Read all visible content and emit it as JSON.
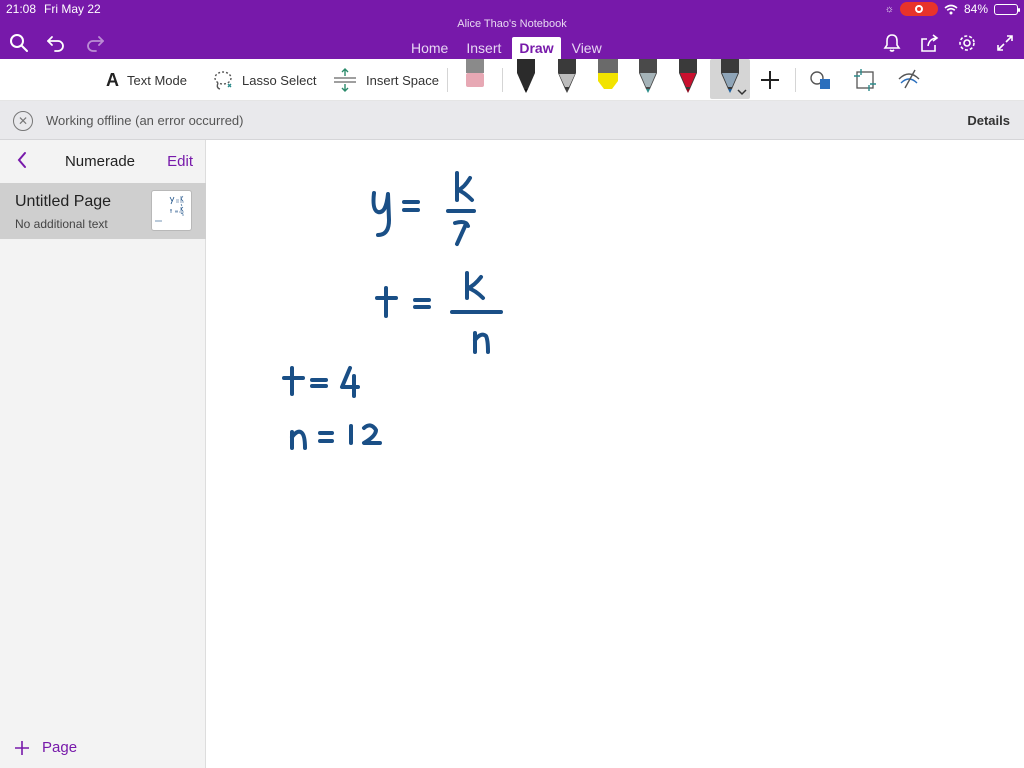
{
  "status_bar": {
    "time": "21:08",
    "date": "Fri May 22",
    "battery": "84%",
    "battery_level": 0.84
  },
  "notebook_title": "Alice Thao's Notebook",
  "tabs": [
    {
      "label": "Home",
      "active": false
    },
    {
      "label": "Insert",
      "active": false
    },
    {
      "label": "Draw",
      "active": true
    },
    {
      "label": "View",
      "active": false
    }
  ],
  "toolbar": {
    "text_mode": "Text Mode",
    "lasso_select": "Lasso Select",
    "insert_space": "Insert Space",
    "text_mode_glyph": "A"
  },
  "pens": [
    {
      "name": "eraser",
      "color": "#e7a8b4"
    },
    {
      "name": "black-pen",
      "color": "#222222"
    },
    {
      "name": "gray-pen",
      "color": "#3a3a3a"
    },
    {
      "name": "yellow-highlighter",
      "color": "#f2e300"
    },
    {
      "name": "teal-pen",
      "color": "#2e8e8a"
    },
    {
      "name": "red-pen",
      "color": "#c8102e"
    },
    {
      "name": "blue-pen",
      "color": "#1d5d9b",
      "selected": true
    }
  ],
  "offline_bar": {
    "message": "Working offline (an error occurred)",
    "details": "Details"
  },
  "sidebar": {
    "section_title": "Numerade",
    "edit_label": "Edit",
    "pages": [
      {
        "title": "Untitled Page",
        "subtitle": "No additional text",
        "selected": true
      }
    ],
    "add_page_label": "Page"
  },
  "colors": {
    "brand": "#7719aa",
    "ink": "#1a4f86"
  },
  "note": {
    "handwriting": [
      "y = k / x",
      "t = k / n",
      "t = 4",
      "n = 12"
    ]
  }
}
